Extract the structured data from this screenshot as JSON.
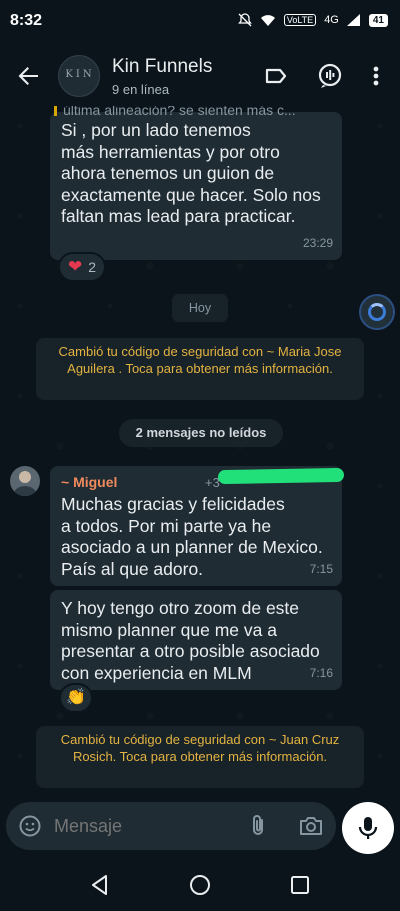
{
  "status": {
    "time": "8:32",
    "volte": "VoLTE",
    "network": "4G",
    "battery": "41"
  },
  "header": {
    "title": "Kin Funnels",
    "subtitle": "9 en línea",
    "avatar_text": "KIN"
  },
  "messages": {
    "m1": {
      "quote": "última alineación? se sienten más c...",
      "text": "Si , por un lado tenemos\nmás herramientas y por otro\nahora tenemos un guion de\nexactamente que hacer. Solo nos\nfaltan mas lead para practicar.",
      "time": "23:29",
      "reaction_count": "2"
    },
    "date_chip": "Hoy",
    "system1": "Cambió tu código de seguridad con ~ Maria Jose Aguilera . Toca para obtener más información.",
    "unread": "2 mensajes no leídos",
    "m2": {
      "sender": "~ Miguel",
      "phone": "+3",
      "text": "Muchas gracias y felicidades\na todos. Por mi parte ya he\nasociado a un planner de Mexico.\nPaís al que adoro.",
      "time": "7:15"
    },
    "m3": {
      "text": "Y hoy tengo otro zoom de este\nmismo planner que me va a\npresentar a otro posible asociado\ncon experiencia en MLM",
      "time": "7:16"
    },
    "system2": "Cambió tu código de seguridad con ~ Juan Cruz Rosich. Toca para obtener más información."
  },
  "input": {
    "placeholder": "Mensaje"
  },
  "colors": {
    "accent_sender": "#f08a5d",
    "system_text": "#e3b341",
    "bubble": "#1f2c34",
    "background": "#0b141a"
  },
  "icons": [
    "back-arrow-icon",
    "label-icon",
    "call-add-icon",
    "more-vert-icon",
    "sticker-icon",
    "attach-icon",
    "camera-icon",
    "mic-icon",
    "nav-back-icon",
    "nav-home-icon",
    "nav-recents-icon"
  ]
}
